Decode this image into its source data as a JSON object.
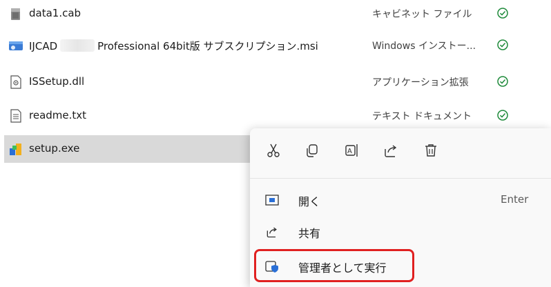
{
  "files": [
    {
      "name": "data1.cab",
      "type": "キャビネット ファイル",
      "icon": "cabinet-file-icon",
      "status": "synced"
    },
    {
      "name_prefix": "IJCAD",
      "name_suffix": "Professional 64bit版 サブスクリプション.msi",
      "type": "Windows インストー...",
      "icon": "msi-installer-icon",
      "status": "synced"
    },
    {
      "name": "ISSetup.dll",
      "type": "アプリケーション拡張",
      "icon": "dll-file-icon",
      "status": "synced"
    },
    {
      "name": "readme.txt",
      "type": "テキスト ドキュメント",
      "icon": "text-file-icon",
      "status": "synced"
    },
    {
      "name": "setup.exe",
      "type": "",
      "icon": "setup-exe-icon",
      "status": ""
    }
  ],
  "context_menu": {
    "toolbar": [
      "cut-icon",
      "copy-icon",
      "rename-icon",
      "share-icon",
      "delete-icon"
    ],
    "items": [
      {
        "label": "開く",
        "accel": "Enter",
        "icon": "open-icon"
      },
      {
        "label": "共有",
        "accel": "",
        "icon": "share-icon"
      },
      {
        "label": "管理者として実行",
        "accel": "",
        "icon": "run-as-admin-shield-icon"
      }
    ]
  },
  "colors": {
    "selection": "#d9d9d9",
    "status_green": "#1e8a3a",
    "highlight_border": "#e02020",
    "menu_bg": "#f9f9f9"
  }
}
